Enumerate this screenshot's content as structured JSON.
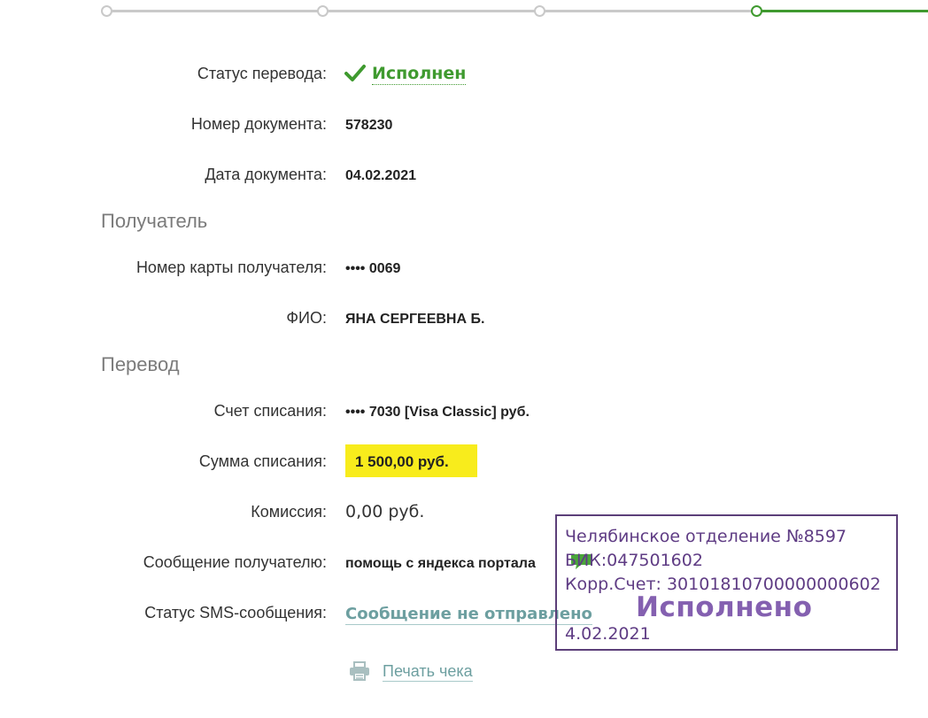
{
  "stepper": {
    "steps_count": 4,
    "current_step": 4
  },
  "status": {
    "label": "Статус перевода:",
    "value": "Исполнен"
  },
  "document": {
    "number_label": "Номер документа:",
    "number_value": "578230",
    "date_label": "Дата документа:",
    "date_value": "04.02.2021"
  },
  "recipient": {
    "section_title": "Получатель",
    "card_label": "Номер карты получателя:",
    "card_value": "•••• 0069",
    "name_label": "ФИО:",
    "name_value": "ЯНА СЕРГЕЕВНА Б."
  },
  "transfer": {
    "section_title": "Перевод",
    "account_label": "Счет списания:",
    "account_value": "•••• 7030  [Visa Classic]  руб.",
    "amount_label": "Сумма списания:",
    "amount_value": "1 500,00  руб.",
    "fee_label": "Комиссия:",
    "fee_value": "0,00 руб.",
    "message_label": "Сообщение получателю:",
    "message_value": "помощь с яндекса портала",
    "sms_label": "Статус SMS-сообщения:",
    "sms_value": "Сообщение не отправлено"
  },
  "print": {
    "label": "Печать чека"
  },
  "stamp": {
    "branch": "Челябинское отделение №8597",
    "bik": "БИК:047501602",
    "corr_account": "Корр.Счет: 30101810700000000602",
    "executed": "Исполнено",
    "date": "4.02.2021"
  },
  "colors": {
    "success": "#3f9a2f",
    "link": "#6d9fa0",
    "highlight": "#f8ec1c",
    "stamp": "#5f3c84"
  },
  "icons": {
    "status": "checkmark-icon",
    "message": "speech-bubble-icon",
    "print": "printer-icon"
  }
}
